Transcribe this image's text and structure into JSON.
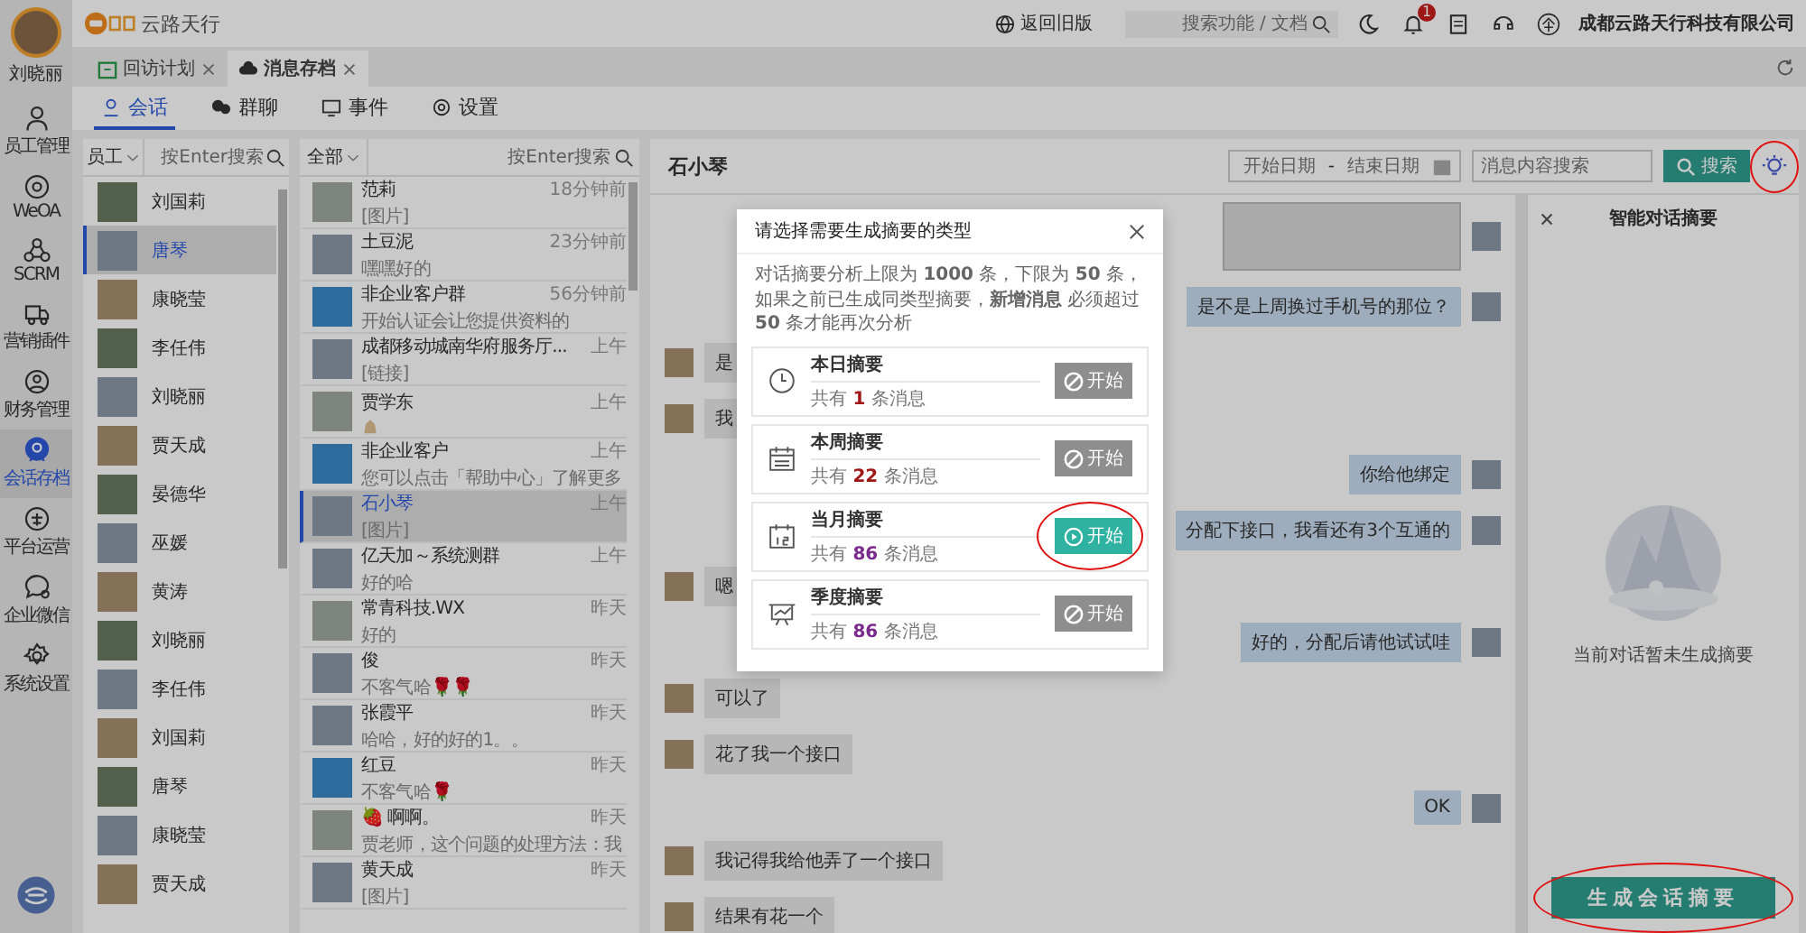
{
  "sidebar": {
    "user_name": "刘晓丽",
    "items": [
      {
        "label": "员工管理",
        "selected": false
      },
      {
        "label": "WeOA",
        "selected": false
      },
      {
        "label": "SCRM",
        "selected": false
      },
      {
        "label": "营销插件",
        "selected": false
      },
      {
        "label": "财务管理",
        "selected": false
      },
      {
        "label": "会话存档",
        "selected": true
      },
      {
        "label": "平台运营",
        "selected": false
      },
      {
        "label": "企业微信",
        "selected": false
      },
      {
        "label": "系统设置",
        "selected": false
      }
    ]
  },
  "header": {
    "logo_text": "云路天行",
    "old_version": "返回旧版",
    "search": {
      "placeholder": "搜索功能 / 文档"
    },
    "notification_count": "1",
    "company": "成都云路天行科技有限公司"
  },
  "tabs": [
    {
      "label": "回访计划",
      "selected": false
    },
    {
      "label": "消息存档",
      "selected": true
    }
  ],
  "sub_tabs": [
    {
      "label": "会话",
      "selected": true
    },
    {
      "label": "群聊",
      "selected": false
    },
    {
      "label": "事件",
      "selected": false
    },
    {
      "label": "设置",
      "selected": false
    }
  ],
  "employees": {
    "filter": "员工",
    "search": {
      "placeholder": "按Enter搜索"
    },
    "items": [
      {
        "name": "刘国莉",
        "selected": false
      },
      {
        "name": "唐琴",
        "selected": true
      },
      {
        "name": "康晓莹",
        "selected": false
      },
      {
        "name": "李任伟",
        "selected": false
      },
      {
        "name": "刘晓丽",
        "selected": false
      },
      {
        "name": "贾天成",
        "selected": false
      },
      {
        "name": "晏德华",
        "selected": false
      },
      {
        "name": "巫媛",
        "selected": false
      },
      {
        "name": "黄涛",
        "selected": false
      },
      {
        "name": "刘晓丽",
        "selected": false
      },
      {
        "name": "李任伟",
        "selected": false
      },
      {
        "name": "刘国莉",
        "selected": false
      },
      {
        "name": "唐琴",
        "selected": false
      },
      {
        "name": "康晓莹",
        "selected": false
      },
      {
        "name": "贾天成",
        "selected": false
      }
    ]
  },
  "conversations": {
    "filter": "全部",
    "search": {
      "placeholder": "按Enter搜索"
    },
    "items": [
      {
        "name": "范莉",
        "time": "18分钟前",
        "preview": "[图片]",
        "selected": false
      },
      {
        "name": "土豆泥",
        "time": "23分钟前",
        "preview": "嘿嘿好的",
        "selected": false
      },
      {
        "name": "非企业客户群",
        "time": "56分钟前",
        "preview": "开始认证会让您提供资料的",
        "selected": false
      },
      {
        "name": "成都移动城南华府服务厅...",
        "time": "上午",
        "preview": "[链接]",
        "selected": false
      },
      {
        "name": "贾学东",
        "time": "上午",
        "emoji": true,
        "selected": false
      },
      {
        "name": "非企业客户",
        "time": "上午",
        "preview": "您可以点击「帮助中心」了解更多",
        "selected": false
      },
      {
        "name": "石小琴",
        "time": "上午",
        "preview": "[图片]",
        "selected": true
      },
      {
        "name": "亿天加～系统测群",
        "time": "上午",
        "preview": "好的哈",
        "selected": false
      },
      {
        "name": "常青科技.WX",
        "time": "昨天",
        "preview": "好的",
        "selected": false
      },
      {
        "name": "俊",
        "time": "昨天",
        "preview": "不客气哈🌹🌹",
        "selected": false
      },
      {
        "name": "张霞平",
        "time": "昨天",
        "preview": "哈哈，好的好的1。。",
        "selected": false
      },
      {
        "name": "红豆",
        "time": "昨天",
        "preview": "不客气哈🌹",
        "selected": false
      },
      {
        "name": "🍓 啊啊。",
        "time": "昨天",
        "preview": "贾老师，这个问题的处理方法：我",
        "selected": false
      },
      {
        "name": "黄天成",
        "time": "昨天",
        "preview": "[图片]",
        "selected": false
      }
    ]
  },
  "chat": {
    "contact": "石小琴",
    "start_date": {
      "placeholder": "开始日期"
    },
    "separator": "-",
    "end_date": {
      "placeholder": "结束日期"
    },
    "search": {
      "placeholder": "消息内容搜索"
    },
    "search_button": "搜索",
    "summary_toggle_circled": true,
    "messages": [
      {
        "kind": "outgoing_image"
      },
      {
        "kind": "outgoing",
        "text": "是不是上周换过手机号的那位？"
      },
      {
        "kind": "incoming",
        "text": "是"
      },
      {
        "kind": "incoming",
        "text": "我"
      },
      {
        "kind": "outgoing",
        "text": "你给他绑定"
      },
      {
        "kind": "outgoing",
        "text": "分配下接口，我看还有3个互通的"
      },
      {
        "kind": "incoming",
        "text": "嗯"
      },
      {
        "kind": "outgoing",
        "text": "好的，分配后请他试试哇"
      },
      {
        "kind": "incoming",
        "text": "可以了"
      },
      {
        "kind": "incoming",
        "text": "花了我一个接口"
      },
      {
        "kind": "outgoing",
        "text": "OK"
      },
      {
        "kind": "incoming",
        "text": "我记得我给他弄了一个接口"
      },
      {
        "kind": "incoming",
        "text": "结果有花一个"
      }
    ]
  },
  "summary_panel": {
    "title": "智能对话摘要",
    "empty_text": "当前对话暂未生成摘要",
    "generate_button": "生成会话摘要",
    "generate_circled": true
  },
  "dialog": {
    "title": "请选择需要生成摘要的类型",
    "intro": "对话摘要分析上限为 **1000** 条，下限为 **50** 条，如果之前已生成同类型摘要，**新增消息** 必须超过 **50** 条才能再次分析",
    "options": [
      {
        "kind": "day",
        "title": "本日摘要",
        "count_prefix": "共有",
        "count": "1",
        "count_suffix": "条消息",
        "color": "#a01818",
        "enabled": false,
        "button": "开始",
        "circled": false
      },
      {
        "kind": "week",
        "title": "本周摘要",
        "count_prefix": "共有",
        "count": "22",
        "count_suffix": "条消息",
        "color": "#a01818",
        "enabled": false,
        "button": "开始",
        "circled": false
      },
      {
        "kind": "month",
        "title": "当月摘要",
        "count_prefix": "共有",
        "count": "86",
        "count_suffix": "条消息",
        "color": "#7a2a8c",
        "enabled": true,
        "button": "开始",
        "circled": true
      },
      {
        "kind": "quarter",
        "title": "季度摘要",
        "count_prefix": "共有",
        "count": "86",
        "count_suffix": "条消息",
        "color": "#7a2a8c",
        "enabled": false,
        "button": "开始",
        "circled": false
      }
    ]
  }
}
